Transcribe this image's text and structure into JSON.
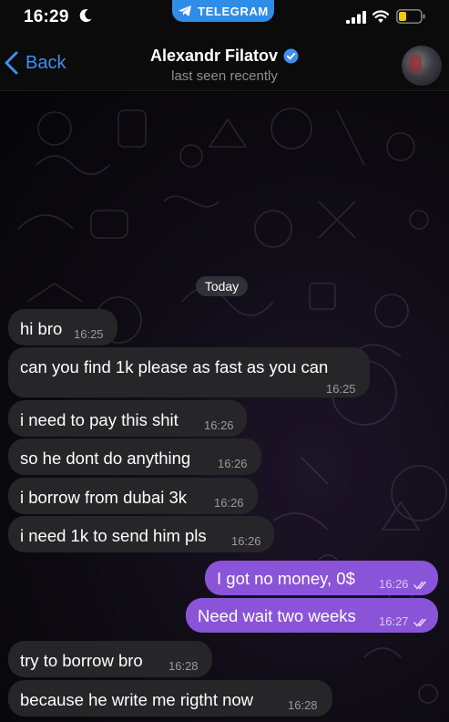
{
  "status_bar": {
    "time": "16:29",
    "pill_label": "TELEGRAM",
    "accent_color": "#2d8de8"
  },
  "header": {
    "back_label": "Back",
    "contact_name": "Alexandr Filatov",
    "last_seen": "last seen recently",
    "icons": [
      "chevron-left-icon",
      "verified-badge-icon",
      "avatar"
    ]
  },
  "chat": {
    "date_chip": "Today",
    "messages": [
      {
        "dir": "in",
        "text": "hi bro",
        "time": "16:25"
      },
      {
        "dir": "in",
        "text": "can you find 1k please as fast as you can",
        "time": "16:25"
      },
      {
        "dir": "in",
        "text": "i need to pay this shit",
        "time": "16:26"
      },
      {
        "dir": "in",
        "text": "so he dont do anything",
        "time": "16:26"
      },
      {
        "dir": "in",
        "text": "i borrow from dubai 3k",
        "time": "16:26"
      },
      {
        "dir": "in",
        "text": "i need 1k to send him pls",
        "time": "16:26"
      },
      {
        "dir": "out",
        "text": "I got no money, 0$",
        "time": "16:26",
        "status": "read"
      },
      {
        "dir": "out",
        "text": "Need wait two weeks",
        "time": "16:27",
        "status": "read"
      },
      {
        "dir": "in",
        "text": "try to borrow bro",
        "time": "16:28"
      },
      {
        "dir": "in",
        "text": "because he write me rigtht now",
        "time": "16:28"
      }
    ],
    "incoming_color": "#262628",
    "outgoing_color": "#8a54d8"
  }
}
